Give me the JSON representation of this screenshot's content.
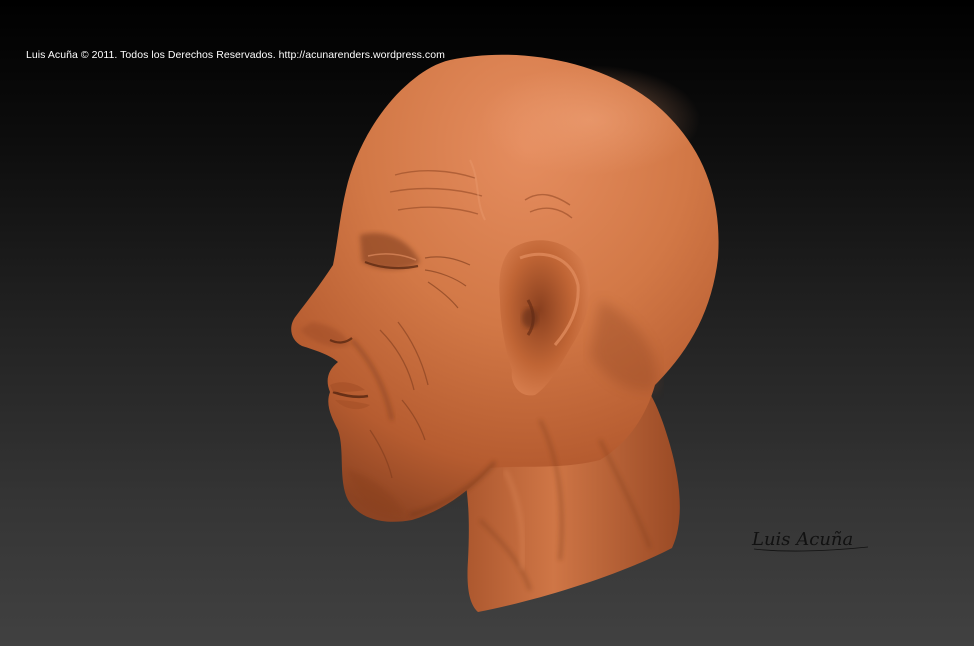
{
  "copyright_notice": "Luis Acuña © 2011. Todos los Derechos Reservados. http://acunarenders.wordpress.com",
  "signature_text": "Luis Acuña",
  "colors": {
    "background_top": "#000000",
    "background_bottom": "#414141",
    "clay_light": "#df8658",
    "clay_mid": "#c4673a",
    "clay_dark": "#6e321a",
    "caption_text": "#ffffff",
    "signature_ink": "#111111"
  },
  "subject": {
    "description": "clay-rendered digital sculpture of a bald elderly man's head in left-facing profile"
  }
}
